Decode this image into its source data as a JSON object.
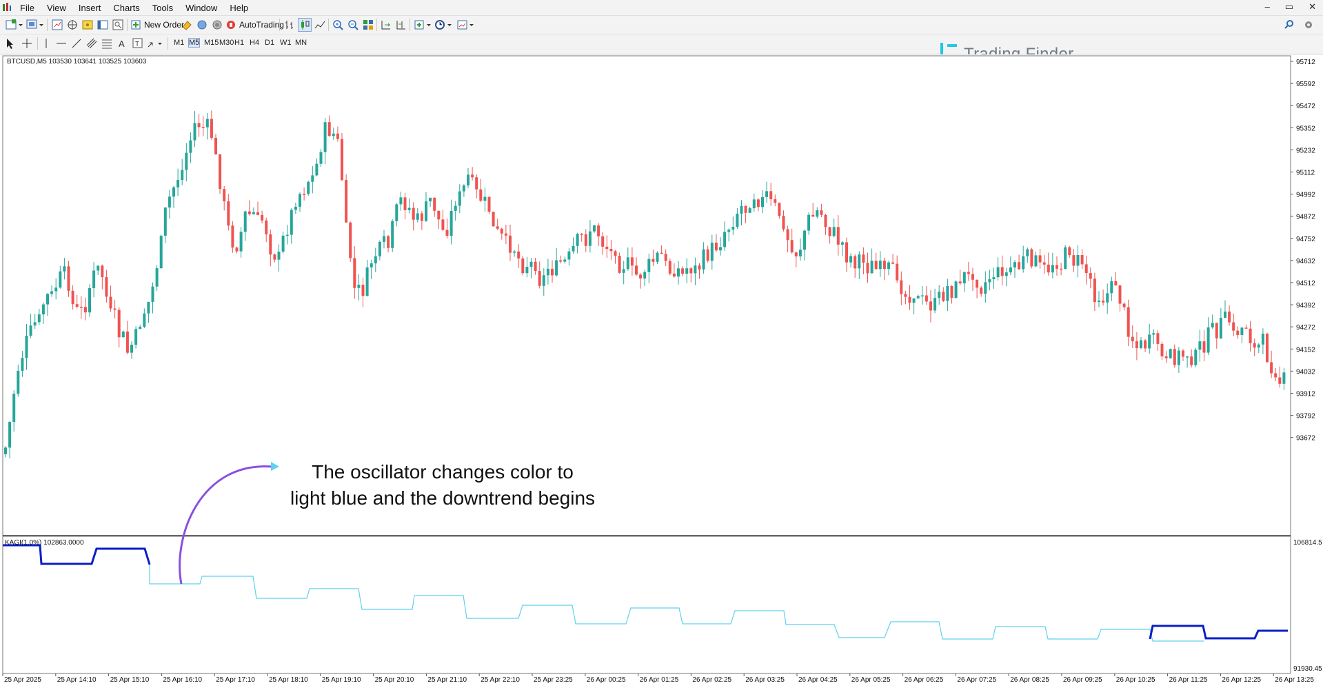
{
  "menu": {
    "items": [
      "File",
      "View",
      "Insert",
      "Charts",
      "Tools",
      "Window",
      "Help"
    ]
  },
  "toolbar": {
    "new_order_label": "New Order",
    "autotrading_label": "AutoTrading",
    "timeframes": [
      "M1",
      "M5",
      "M15",
      "M30",
      "H1",
      "H4",
      "D1",
      "W1",
      "MN"
    ]
  },
  "brand": {
    "name": "Trading Finder",
    "color": "#1ec8e6"
  },
  "chart": {
    "header": "BTCUSD,M5  103530 103641 103525 103603",
    "price_ticks": [
      "95712",
      "95592",
      "95472",
      "95352",
      "95232",
      "95112",
      "94992",
      "94872",
      "94752",
      "94632",
      "94512",
      "94392",
      "94272",
      "94152",
      "94032",
      "93912",
      "93792",
      "93672"
    ],
    "time_ticks": [
      "25 Apr 2025",
      "25 Apr 14:10",
      "25 Apr 15:10",
      "25 Apr 16:10",
      "25 Apr 17:10",
      "25 Apr 18:10",
      "25 Apr 19:10",
      "25 Apr 20:10",
      "25 Apr 21:10",
      "25 Apr 22:10",
      "25 Apr 23:25",
      "26 Apr 00:25",
      "26 Apr 01:25",
      "26 Apr 02:25",
      "26 Apr 03:25",
      "26 Apr 04:25",
      "26 Apr 05:25",
      "26 Apr 06:25",
      "26 Apr 07:25",
      "26 Apr 08:25",
      "26 Apr 09:25",
      "26 Apr 10:25",
      "26 Apr 11:25",
      "26 Apr 12:25",
      "26 Apr 13:25"
    ],
    "bull_color": "#26a69a",
    "bear_color": "#ef5350"
  },
  "indicator": {
    "label": "KAGI(1.0%) 102863.0000",
    "scale_top": "106814.5",
    "scale_bottom": "91930.45",
    "yang_color": "#0a1ec8",
    "yin_color": "#5fd0ef"
  },
  "annotation": {
    "line1": "The oscillator changes color to",
    "line2": "light blue and the downtrend begins",
    "arrow_color": "#8a4fe0"
  }
}
